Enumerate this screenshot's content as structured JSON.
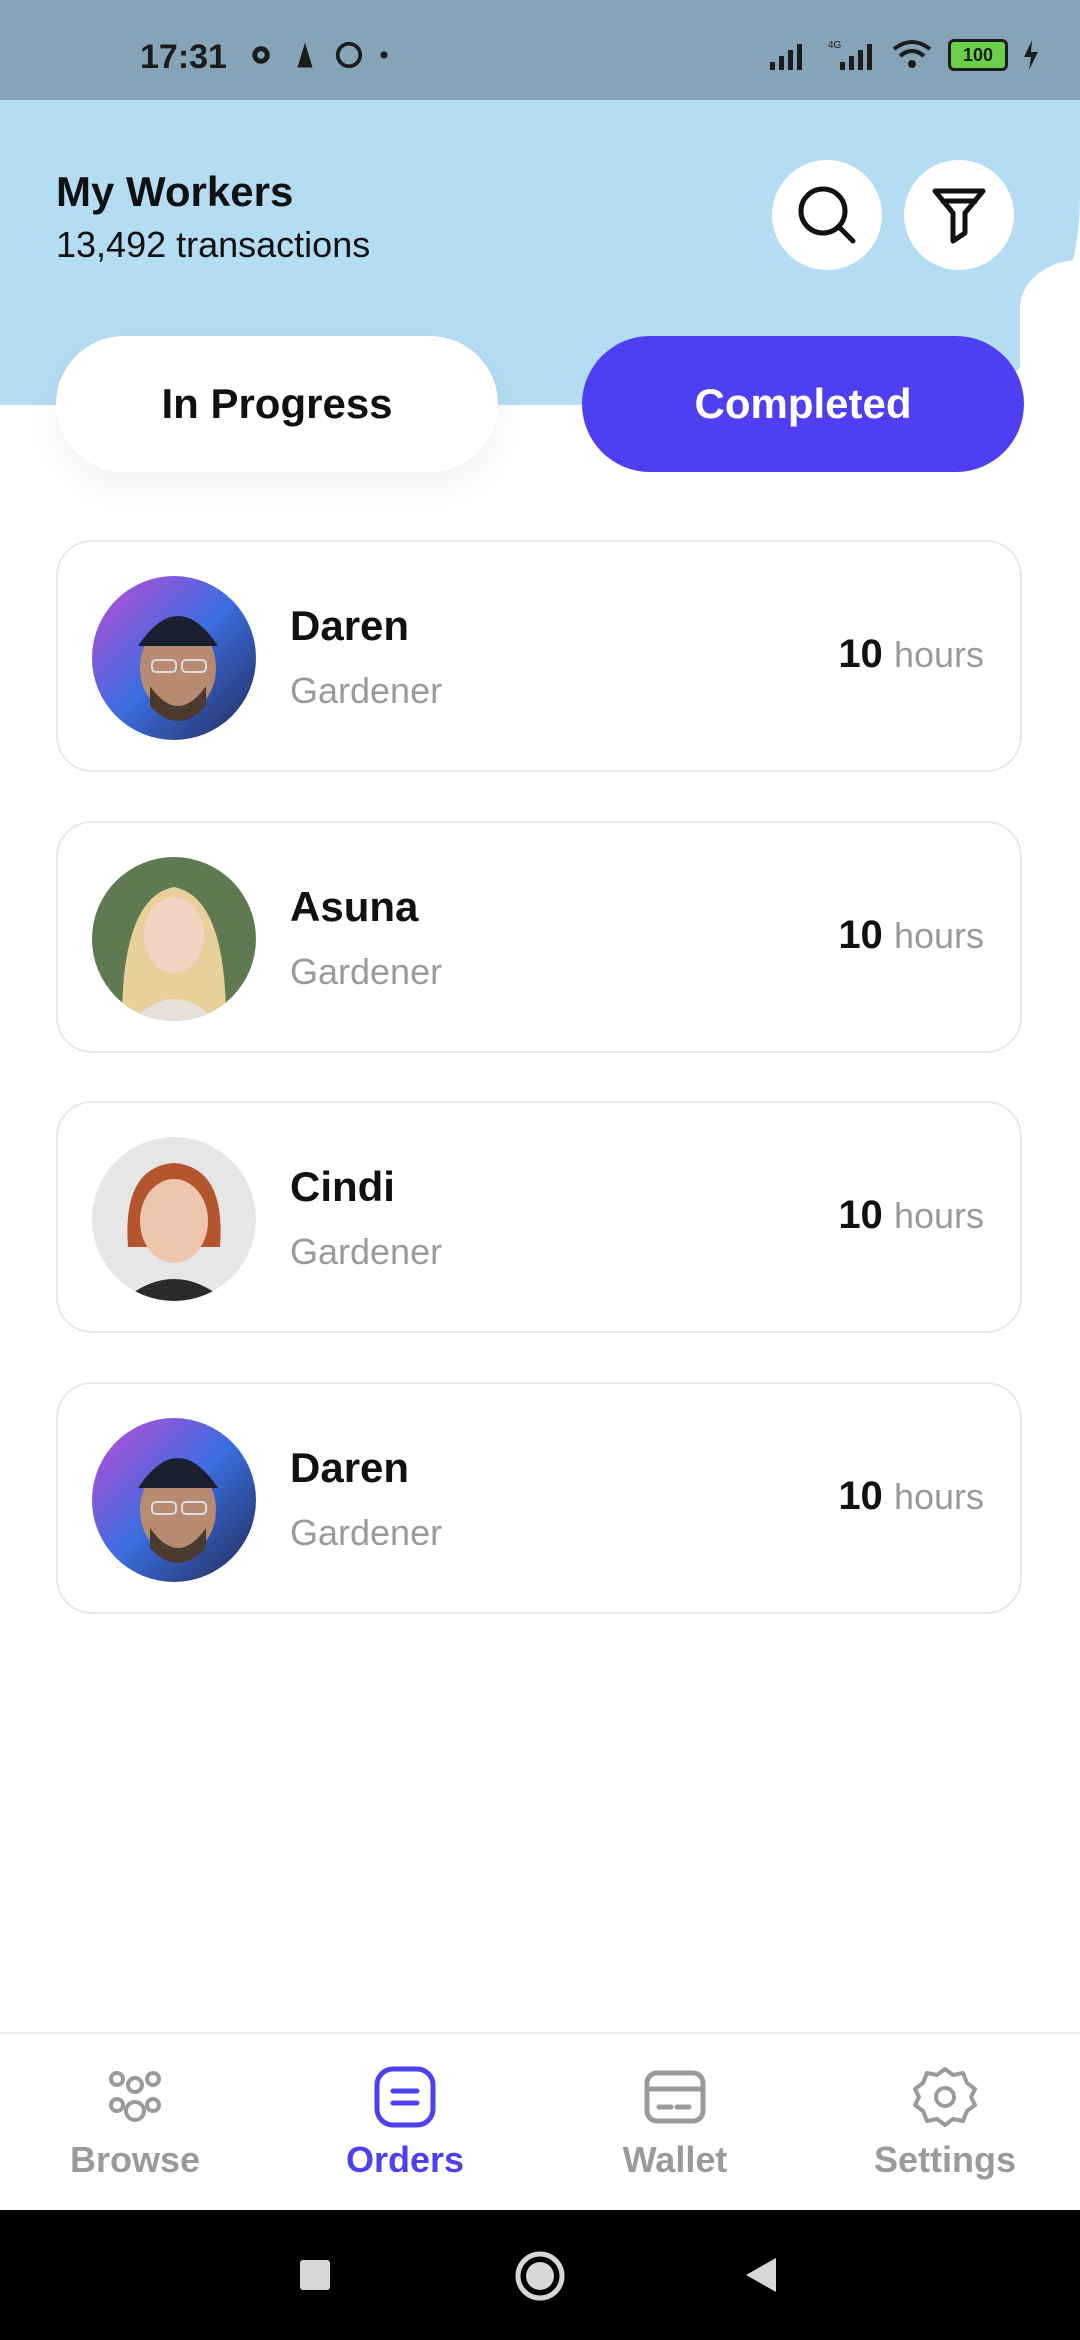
{
  "status_bar": {
    "time": "17:31",
    "battery": "100",
    "network": "4G"
  },
  "header": {
    "title": "My Workers",
    "subtitle": "13,492 transactions",
    "search_icon": "search-icon",
    "filter_icon": "filter-icon"
  },
  "tabs": [
    {
      "label": "In Progress",
      "active": false
    },
    {
      "label": "Completed",
      "active": true
    }
  ],
  "workers": [
    {
      "name": "Daren",
      "role": "Gardener",
      "hours": "10",
      "unit": "hours"
    },
    {
      "name": "Asuna",
      "role": "Gardener",
      "hours": "10",
      "unit": "hours"
    },
    {
      "name": "Cindi",
      "role": "Gardener",
      "hours": "10",
      "unit": "hours"
    },
    {
      "name": "Daren",
      "role": "Gardener",
      "hours": "10",
      "unit": "hours"
    }
  ],
  "bottom_nav": [
    {
      "label": "Browse",
      "icon": "browse-icon",
      "active": false
    },
    {
      "label": "Orders",
      "icon": "orders-icon",
      "active": true
    },
    {
      "label": "Wallet",
      "icon": "wallet-icon",
      "active": false
    },
    {
      "label": "Settings",
      "icon": "settings-icon",
      "active": false
    }
  ],
  "colors": {
    "accent": "#4e3ff0",
    "header_bg": "#b4dcf2",
    "muted_text": "#9a9a9a"
  }
}
